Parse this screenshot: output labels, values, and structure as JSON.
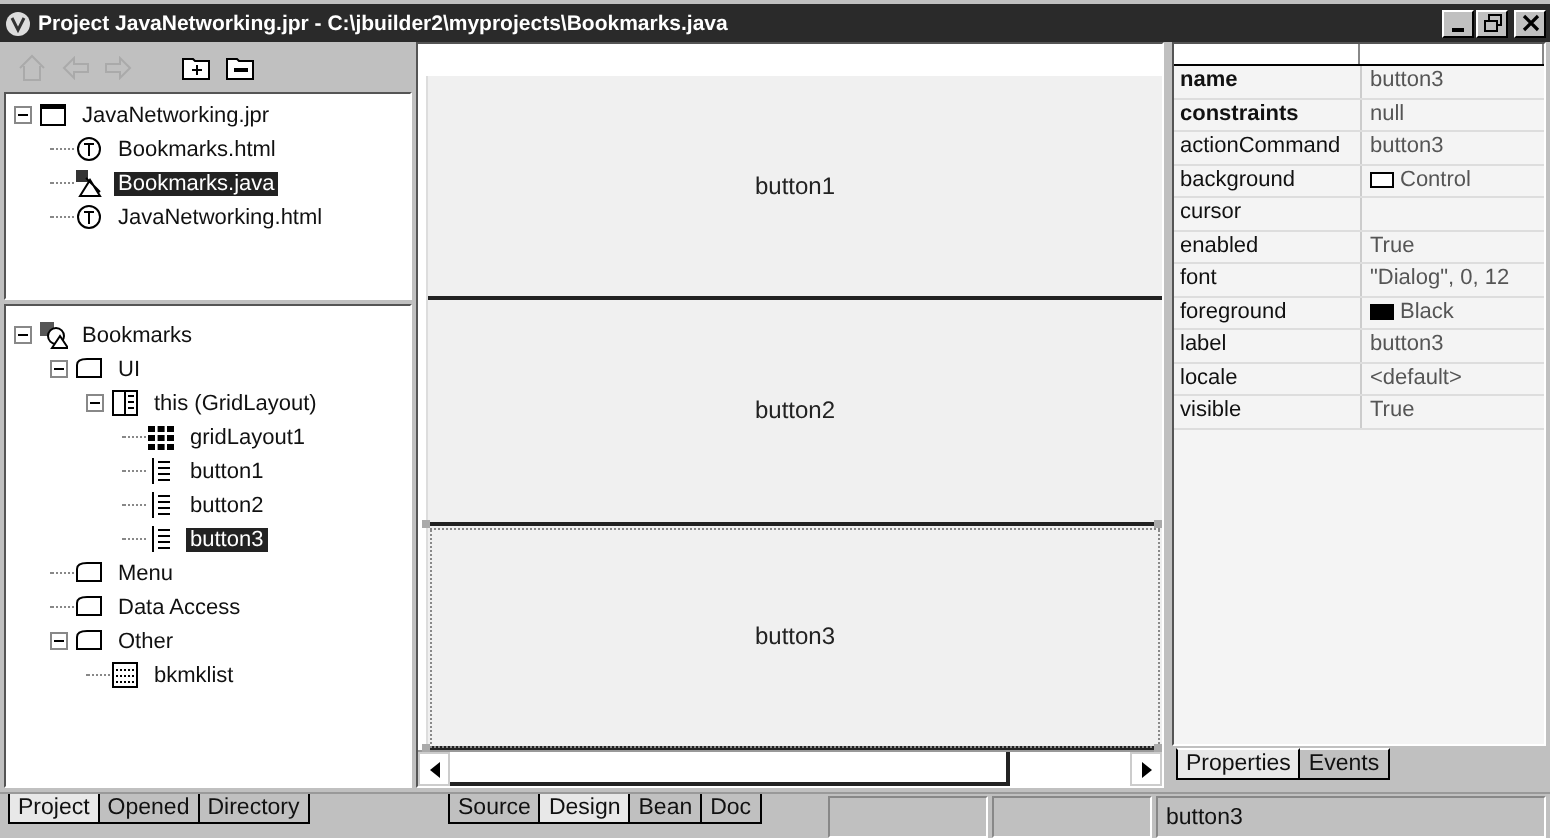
{
  "window": {
    "title": "Project JavaNetworking.jpr - C:\\jbuilder2\\myprojects\\Bookmarks.java"
  },
  "project_tree": [
    {
      "label": "JavaNetworking.jpr",
      "kind": "project",
      "selected": false,
      "expanded": true,
      "children": [
        {
          "label": "Bookmarks.html",
          "kind": "html",
          "selected": false
        },
        {
          "label": "Bookmarks.java",
          "kind": "java",
          "selected": true
        },
        {
          "label": "JavaNetworking.html",
          "kind": "html",
          "selected": false
        }
      ]
    }
  ],
  "structure_tree": [
    {
      "label": "Bookmarks",
      "kind": "class",
      "selected": false,
      "expanded": true,
      "children": [
        {
          "label": "UI",
          "kind": "folder",
          "selected": false,
          "expanded": true,
          "children": [
            {
              "label": "this (GridLayout)",
              "kind": "container",
              "selected": false,
              "expanded": true,
              "children": [
                {
                  "label": "gridLayout1",
                  "kind": "grid",
                  "selected": false
                },
                {
                  "label": "button1",
                  "kind": "button",
                  "selected": false
                },
                {
                  "label": "button2",
                  "kind": "button",
                  "selected": false
                },
                {
                  "label": "button3",
                  "kind": "button",
                  "selected": true
                }
              ]
            }
          ]
        },
        {
          "label": "Menu",
          "kind": "folder",
          "selected": false
        },
        {
          "label": "Data Access",
          "kind": "folder",
          "selected": false
        },
        {
          "label": "Other",
          "kind": "folder",
          "selected": false,
          "expanded": true,
          "children": [
            {
              "label": "bkmklist",
              "kind": "list",
              "selected": false
            }
          ]
        }
      ]
    }
  ],
  "left_tabs": [
    {
      "label": "Project",
      "selected": true
    },
    {
      "label": "Opened",
      "selected": false
    },
    {
      "label": "Directory",
      "selected": false
    }
  ],
  "design": {
    "buttons": [
      {
        "label": "button1",
        "selected": false
      },
      {
        "label": "button2",
        "selected": false
      },
      {
        "label": "button3",
        "selected": true
      }
    ]
  },
  "editor_tabs": [
    {
      "label": "Source",
      "selected": false
    },
    {
      "label": "Design",
      "selected": true
    },
    {
      "label": "Bean",
      "selected": false
    },
    {
      "label": "Doc",
      "selected": false
    }
  ],
  "inspector": {
    "properties": [
      {
        "name": "name",
        "bold": true,
        "value": "button3"
      },
      {
        "name": "constraints",
        "bold": true,
        "value": "null"
      },
      {
        "name": "actionCommand",
        "bold": false,
        "value": "button3"
      },
      {
        "name": "background",
        "bold": false,
        "value": "Control",
        "color": "#ffffff"
      },
      {
        "name": "cursor",
        "bold": false
      },
      {
        "name": "enabled",
        "bold": false,
        "value": "True"
      },
      {
        "name": "font",
        "bold": false,
        "value": "\"Dialog\", 0, 12"
      },
      {
        "name": "foreground",
        "bold": false,
        "value": "Black",
        "color": "#000000"
      },
      {
        "name": "label",
        "bold": false,
        "value": "button3"
      },
      {
        "name": "locale",
        "bold": false,
        "value": "<default>"
      },
      {
        "name": "visible",
        "bold": false,
        "value": "True"
      }
    ],
    "tabs": [
      {
        "label": "Properties",
        "selected": true
      },
      {
        "label": "Events",
        "selected": false
      }
    ]
  },
  "status_bar": {
    "message": "button3"
  }
}
